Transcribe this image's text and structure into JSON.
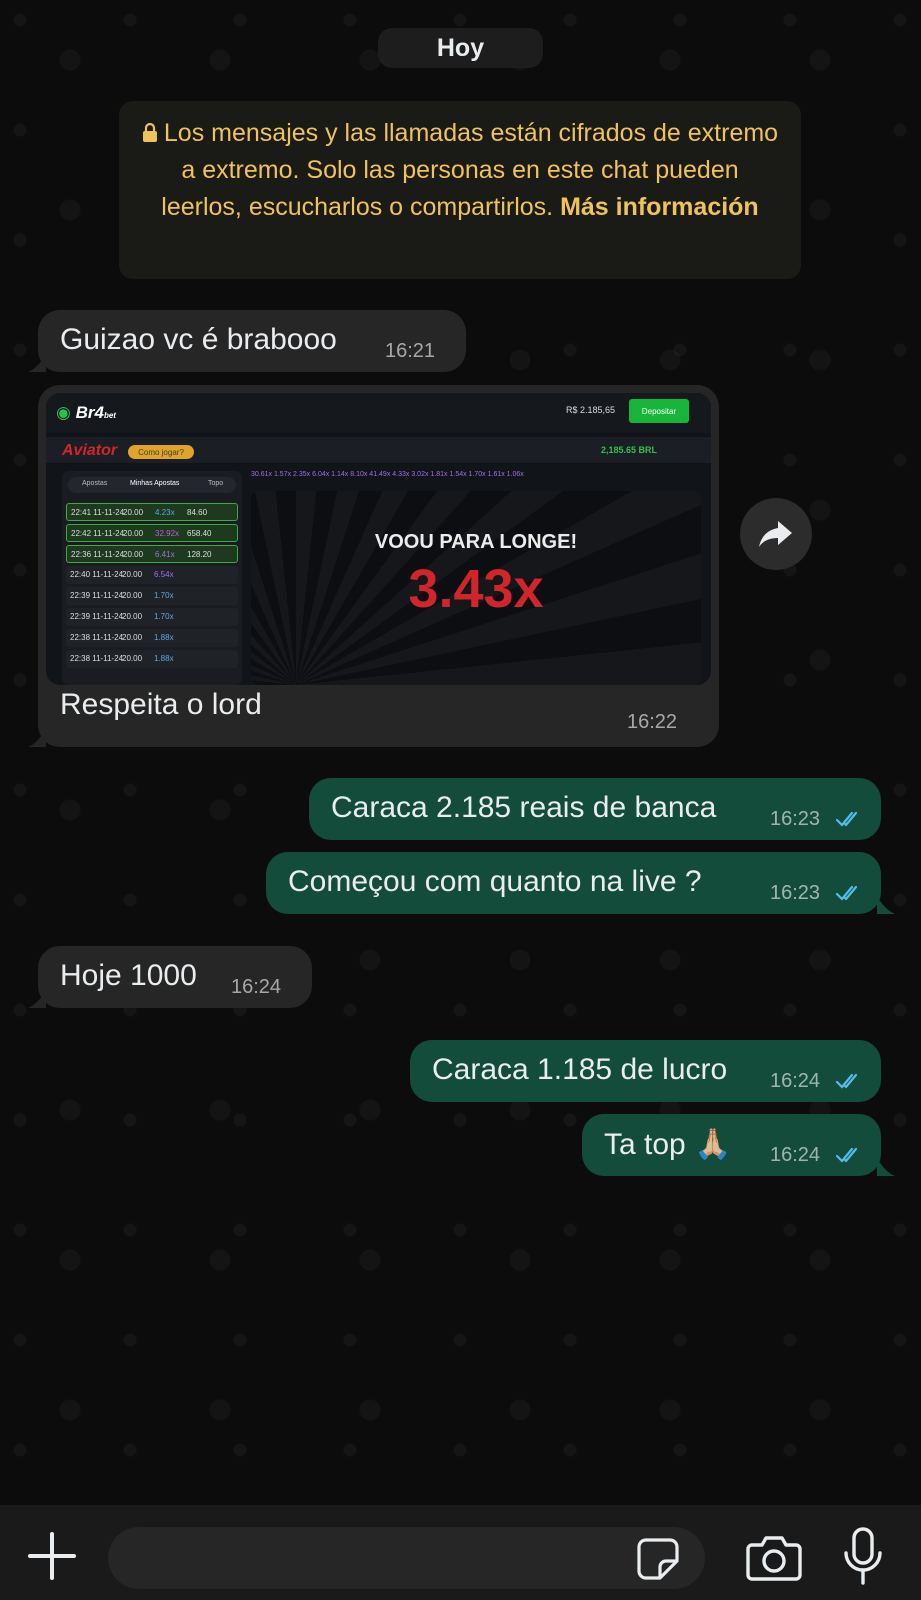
{
  "date_separator": "Hoy",
  "encryption_notice": {
    "text": "Los mensajes y las llamadas están cifrados de extremo a extremo. Solo las personas en este chat pueden leerlos, escucharlos o compartirlos.",
    "link": "Más información"
  },
  "messages": [
    {
      "direction": "in",
      "text": "Guizao vc é brabooo",
      "time": "16:21"
    },
    {
      "direction": "in",
      "type": "image",
      "caption": "Respeita o lord",
      "time": "16:22"
    },
    {
      "direction": "out",
      "text": "Caraca 2.185 reais de banca",
      "time": "16:23",
      "status": "read"
    },
    {
      "direction": "out",
      "text": "Começou com quanto na live  ?",
      "time": "16:23",
      "status": "read"
    },
    {
      "direction": "in",
      "text": "Hoje 1000",
      "time": "16:24"
    },
    {
      "direction": "out",
      "text": "Caraca 1.185 de lucro",
      "time": "16:24",
      "status": "read"
    },
    {
      "direction": "out",
      "text": "Ta top 🙏🏼",
      "time": "16:24",
      "status": "read"
    }
  ],
  "shared_image": {
    "brand_prefix": "Br4",
    "brand_suffix": "bet",
    "balance_top": "R$ 2.185,65",
    "deposit_button": "Depositar",
    "game_name": "Aviator",
    "how_to_play": "Como jogar?",
    "balance_game": "2,185.65 BRL",
    "tabs": [
      "Apostas",
      "Minhas Apostas",
      "Topo"
    ],
    "bet_rows": [
      {
        "date": "22:41 11-11-24",
        "bet": "20.00",
        "mult": "4.23x",
        "win": "84.60"
      },
      {
        "date": "22:42 11-11-24",
        "bet": "20.00",
        "mult": "32.92x",
        "win": "658.40"
      },
      {
        "date": "22:36 11-11-24",
        "bet": "20.00",
        "mult": "6.41x",
        "win": "128.20"
      },
      {
        "date": "22:40 11-11-24",
        "bet": "20.00",
        "mult": "6.54x",
        "win": ""
      },
      {
        "date": "22:39 11-11-24",
        "bet": "20.00",
        "mult": "1.70x",
        "win": ""
      },
      {
        "date": "22:39 11-11-24",
        "bet": "20.00",
        "mult": "1.70x",
        "win": ""
      },
      {
        "date": "22:38 11-11-24",
        "bet": "20.00",
        "mult": "1.88x",
        "win": ""
      },
      {
        "date": "22:38 11-11-24",
        "bet": "20.00",
        "mult": "1.88x",
        "win": ""
      }
    ],
    "multiplier_history": "30.61x  1.57x  2.35x  6.04x  1.14x  8.10x  41.49x  4.33x  3.02x  1.81x  1.54x  1.70x  1.61x  1.06x",
    "flew_away": "VOOU PARA LONGE!",
    "multiplier": "3.43x"
  },
  "colors": {
    "incoming_bubble": "#262626",
    "outgoing_bubble": "#134c3a",
    "notice_text": "#f0c25b",
    "read_ticks": "#53bdeb"
  },
  "composer": {
    "icons": [
      "plus-icon",
      "sticker-icon",
      "camera-icon",
      "microphone-icon"
    ]
  }
}
